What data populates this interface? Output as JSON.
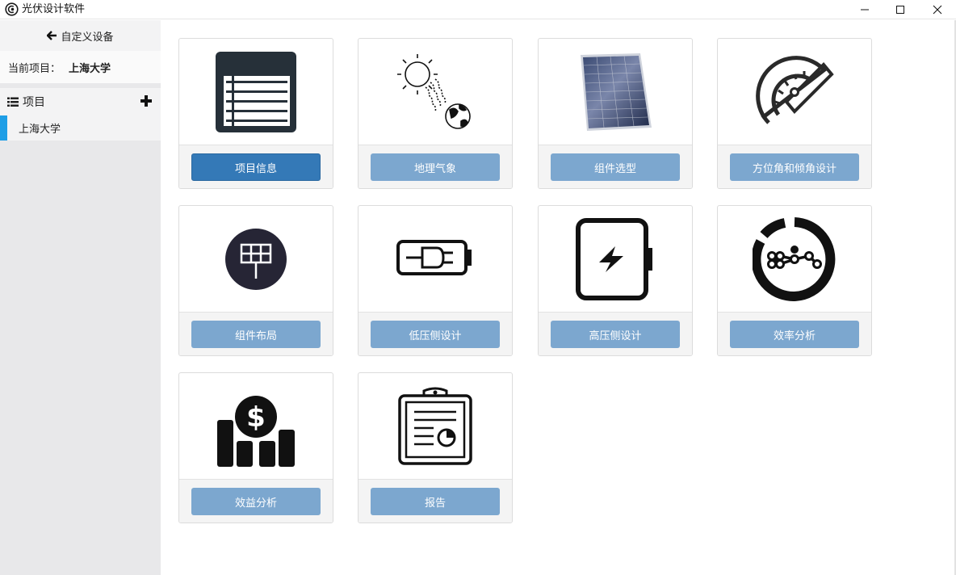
{
  "window": {
    "title": "光伏设计软件"
  },
  "sidebar": {
    "back_label": "自定义设备",
    "current_project_label": "当前项目：",
    "current_project_value": "上海大学",
    "projects_header": "项目",
    "projects": [
      "上海大学"
    ]
  },
  "cards": [
    {
      "label": "项目信息",
      "icon": "table-icon",
      "active": true
    },
    {
      "label": "地理气象",
      "icon": "sun-earth-icon",
      "active": false
    },
    {
      "label": "组件选型",
      "icon": "solar-panel-icon",
      "active": false
    },
    {
      "label": "方位角和倾角设计",
      "icon": "protractor-icon",
      "active": false
    },
    {
      "label": "组件布局",
      "icon": "panel-layout-icon",
      "active": false
    },
    {
      "label": "低压侧设计",
      "icon": "plug-battery-icon",
      "active": false
    },
    {
      "label": "高压侧设计",
      "icon": "lightning-battery-icon",
      "active": false
    },
    {
      "label": "效率分析",
      "icon": "efficiency-chart-icon",
      "active": false
    },
    {
      "label": "效益分析",
      "icon": "dollar-bars-icon",
      "active": false
    },
    {
      "label": "报告",
      "icon": "clipboard-report-icon",
      "active": false
    }
  ],
  "colors": {
    "active_button": "#3479b7",
    "inactive_button": "#7ca7cf",
    "accent": "#1e9ee6"
  }
}
